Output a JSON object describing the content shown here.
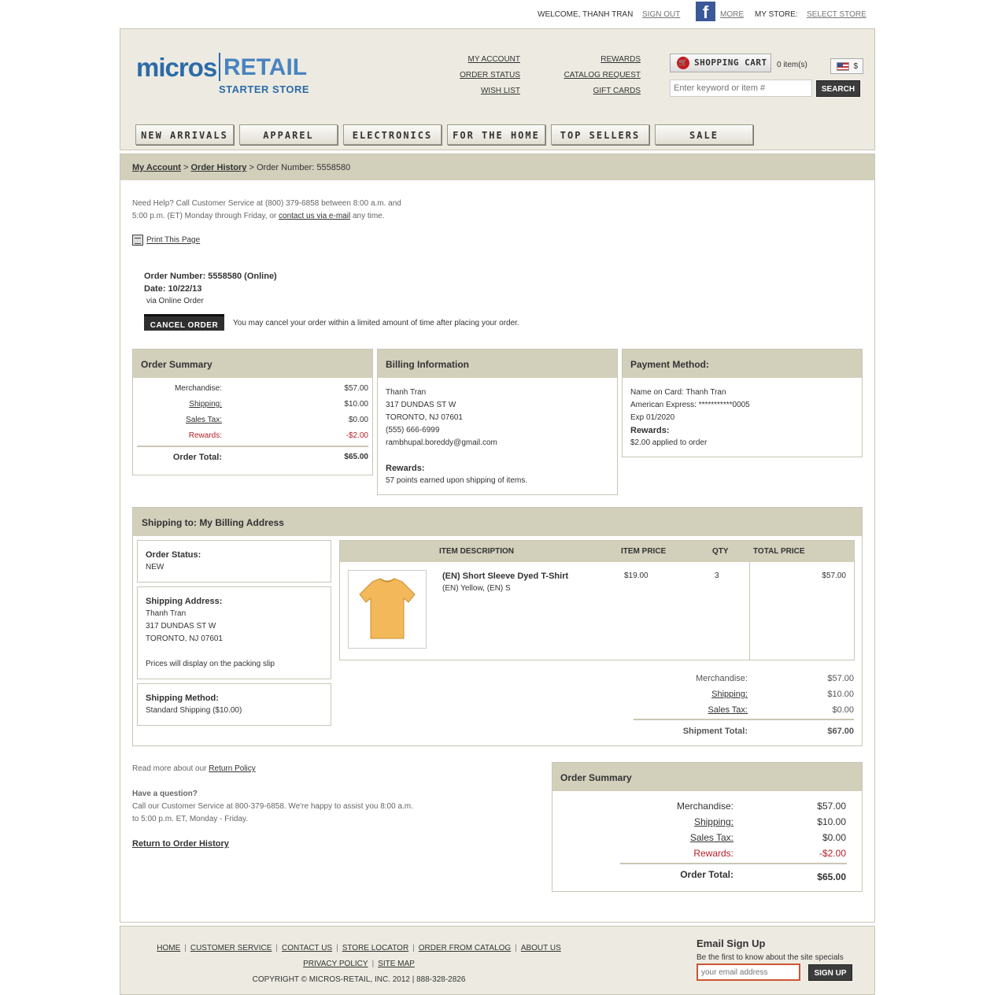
{
  "util": {
    "welcome": "WELCOME, THANH TRAN",
    "sign_out": "SIGN OUT",
    "more": "MORE",
    "my_store_label": "MY STORE:",
    "select_store": "SELECT STORE"
  },
  "header": {
    "logo_main": "micros",
    "logo_retail": "RETAIL",
    "logo_sub": "STARTER STORE",
    "links_col1": [
      "MY ACCOUNT",
      "ORDER STATUS",
      "WISH LIST"
    ],
    "links_col2": [
      "REWARDS",
      "CATALOG REQUEST",
      "GIFT CARDS"
    ],
    "cart_label": "SHOPPING CART",
    "cart_items": "0 item(s)",
    "currency": "$",
    "search_placeholder": "Enter keyword or item #",
    "search_button": "SEARCH",
    "nav": [
      "NEW ARRIVALS",
      "APPAREL",
      "ELECTRONICS",
      "FOR THE HOME",
      "TOP SELLERS",
      "SALE"
    ]
  },
  "breadcrumb": {
    "my_account": "My Account",
    "order_history": "Order History",
    "current": "Order Number: 5558580"
  },
  "help": {
    "line1": "Need Help?  Call Customer Service at (800) 379-6858 between 8:00 a.m. and",
    "line2a": "5:00 p.m. (ET) Monday through Friday, or ",
    "line2_link": "contact us via e-mail",
    "line2b": " any time.",
    "print": "Print This Page"
  },
  "order": {
    "number": "Order Number: 5558580 (Online)",
    "date": "Date: 10/22/13",
    "via": "via Online Order",
    "cancel_button": "CANCEL ORDER",
    "cancel_note": "You may cancel your order within a limited amount of time after placing your order."
  },
  "summary": {
    "title": "Order Summary",
    "merchandise_label": "Merchandise:",
    "merchandise": "$57.00",
    "shipping_label": "Shipping:",
    "shipping": "$10.00",
    "tax_label": "Sales Tax:",
    "tax": "$0.00",
    "rewards_label": "Rewards:",
    "rewards": "-$2.00",
    "total_label": "Order Total:",
    "total": "$65.00"
  },
  "billing": {
    "title": "Billing Information",
    "name": "Thanh Tran",
    "street": "317 DUNDAS ST W",
    "city": "TORONTO, NJ 07601",
    "phone": "(555) 666-6999",
    "email": "rambhupal.boreddy@gmail.com",
    "rewards_label": "Rewards:",
    "rewards_text": "57 points earned upon shipping of items."
  },
  "payment": {
    "title": "Payment Method:",
    "name_on_card": "Name on Card: Thanh Tran",
    "card": "American Express: ***********0005",
    "exp": "Exp 01/2020",
    "rewards_label": "Rewards:",
    "rewards_text": "$2.00 applied to order"
  },
  "shipping": {
    "title": "Shipping to:  My Billing Address",
    "status_label": "Order Status:",
    "status": "NEW",
    "address_label": "Shipping Address:",
    "address_name": "Thanh Tran",
    "address_street": "317 DUNDAS ST W",
    "address_city": "TORONTO, NJ 07601",
    "address_note": "Prices will display on the packing slip",
    "method_label": "Shipping Method:",
    "method": "Standard Shipping ($10.00)",
    "table_headers": [
      "ITEM DESCRIPTION",
      "ITEM PRICE",
      "QTY",
      "TOTAL PRICE"
    ],
    "item": {
      "name": "(EN) Short Sleeve Dyed T-Shirt",
      "variant": "(EN) Yellow, (EN) S",
      "price": "$19.00",
      "qty": "3",
      "total": "$57.00"
    },
    "merch_label": "Merchandise:",
    "merch": "$57.00",
    "ship_label": "Shipping:",
    "ship": "$10.00",
    "tax_label": "Sales Tax:",
    "tax": "$0.00",
    "total_label": "Shipment Total:",
    "total": "$67.00"
  },
  "bottom": {
    "return_prefix": "Read more about our ",
    "return_link": "Return Policy",
    "question": "Have a question?",
    "q_line1": "Call our Customer Service at 800-379-6858. We're happy to assist you 8:00 a.m.",
    "q_line2": "to 5:00 p.m. ET, Monday - Friday.",
    "return_history": "Return to Order History"
  },
  "footer": {
    "links_row1": [
      "HOME",
      "CUSTOMER SERVICE",
      "CONTACT US",
      "STORE LOCATOR",
      "ORDER FROM CATALOG",
      "ABOUT US"
    ],
    "links_row2": [
      "PRIVACY POLICY",
      "SITE MAP"
    ],
    "copyright": "COPYRIGHT © MICROS-RETAIL, INC. 2012 | 888-328-2826",
    "email_title": "Email Sign Up",
    "email_sub": "Be the first to know about the site specials",
    "email_placeholder": "your email address",
    "signup": "SIGN UP"
  },
  "colors": {
    "panel": "#d2cfbb",
    "header_bg": "#edebe1",
    "accent_blue": "#2c6ba8",
    "rewards_red": "#b5212a"
  }
}
